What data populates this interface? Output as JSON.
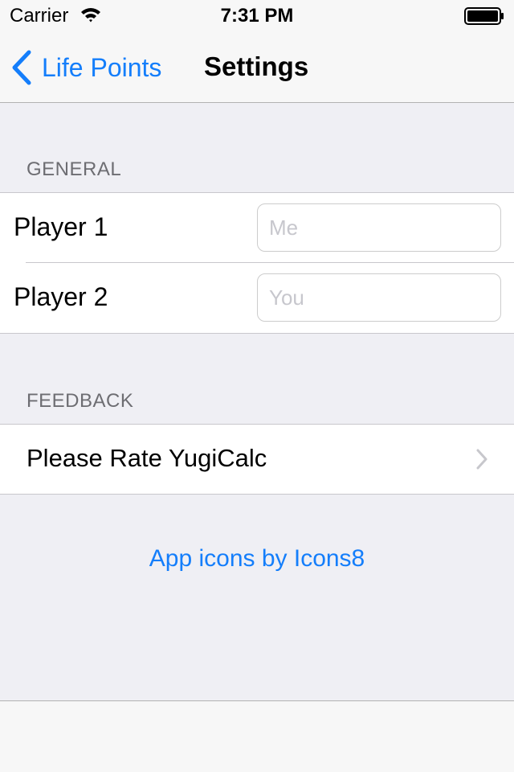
{
  "status_bar": {
    "carrier": "Carrier",
    "time": "7:31 PM",
    "wifi_icon": "wifi-icon",
    "battery_icon": "battery-icon"
  },
  "nav": {
    "back_label": "Life Points",
    "back_icon": "chevron-left-icon",
    "title": "Settings"
  },
  "general": {
    "header": "GENERAL",
    "rows": [
      {
        "label": "Player 1",
        "value": "",
        "placeholder": "Me"
      },
      {
        "label": "Player 2",
        "value": "",
        "placeholder": "You"
      }
    ]
  },
  "feedback": {
    "header": "FEEDBACK",
    "rate_label": "Please Rate YugiCalc",
    "disclosure_icon": "chevron-right-icon"
  },
  "credits": {
    "link_label": "App icons by Icons8"
  },
  "colors": {
    "accent": "#147efb",
    "background": "#efeff4",
    "section_header": "#6d6d72",
    "separator": "#c8c7cc",
    "bar_background": "#f7f7f7"
  }
}
